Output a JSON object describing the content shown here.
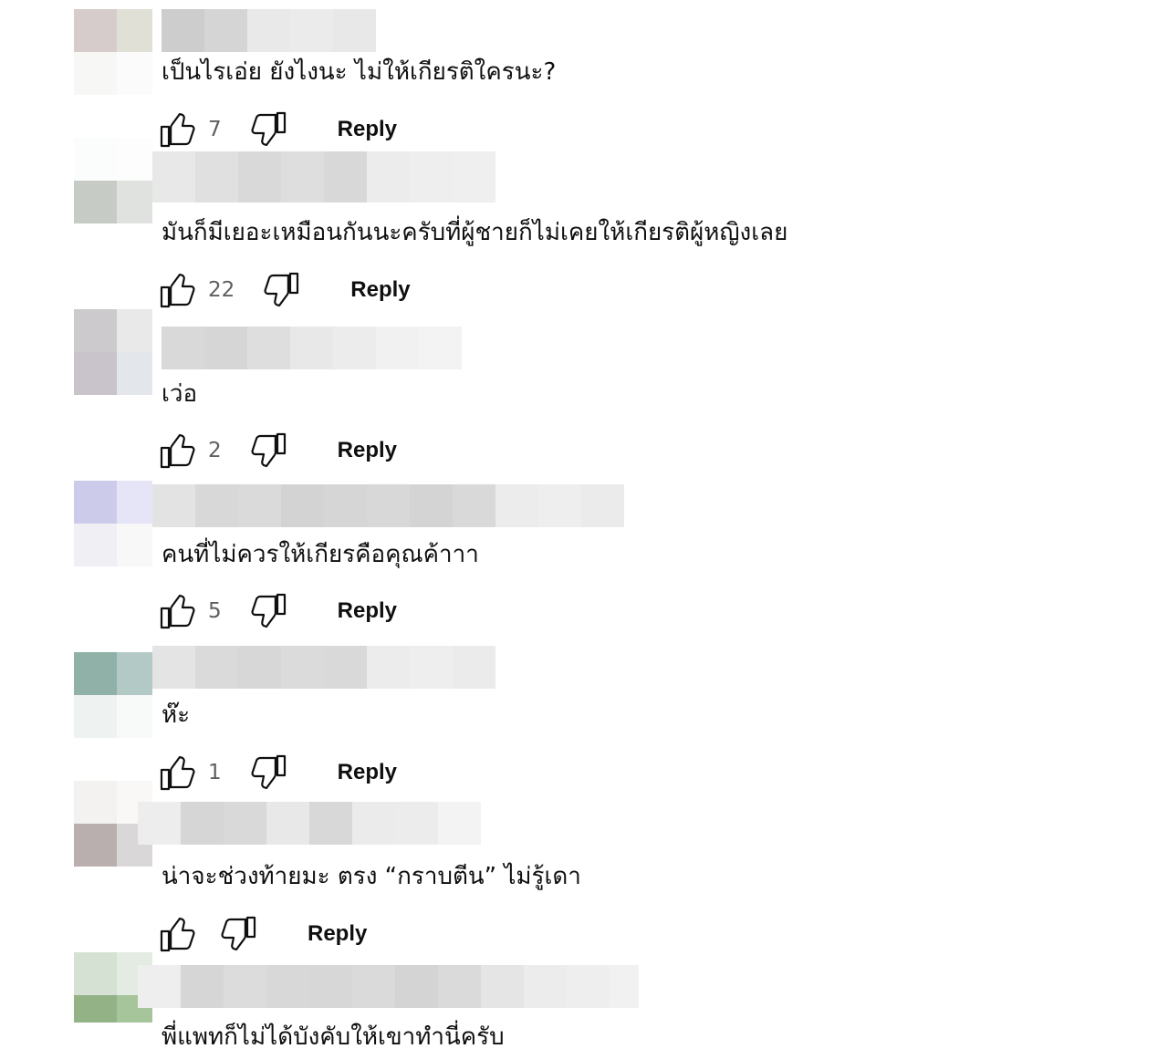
{
  "comments": [
    {
      "text": "เป็นไรเอ่ย ยังไงนะ ไม่ให้เกียรติใครนะ?",
      "likes": "7",
      "reply_label": "Reply",
      "avatar_colors": [
        "#d7cccc",
        "#e0e0d6",
        "#f7f7f5",
        "#fbfbfb"
      ],
      "name_blur_colors": [
        "#cdcdcd",
        "#d5d5d5",
        "#e9e9e9",
        "#ebebeb",
        "#e8e8e8"
      ]
    },
    {
      "text": "มันก็มีเยอะเหมือนกันนะครับที่ผู้ชายก็ไม่เคยให้เกียรติผู้หญิงเลย",
      "likes": "22",
      "reply_label": "Reply",
      "avatar_colors": [
        "#fbfdfc",
        "#fdfdfd",
        "#c6cbc6",
        "#dfe2df"
      ],
      "name_blur_colors": [
        "#e8e8e8",
        "#e0e0e0",
        "#d9d9d9",
        "#dedede",
        "#d8d8d8",
        "#ececec",
        "#eeeeee",
        "#efefef"
      ]
    },
    {
      "text": "เว่อ",
      "likes": "2",
      "reply_label": "Reply",
      "avatar_colors": [
        "#cdcacd",
        "#e9e9e9",
        "#c9c3cc",
        "#e3e6ea"
      ],
      "name_blur_colors": [
        "#d9d9d9",
        "#d6d6d6",
        "#dedede",
        "#e8e8e8",
        "#ececec",
        "#f1f1f1",
        "#f3f3f3"
      ]
    },
    {
      "text": "คนที่ไม่ควรให้เกียรคือคุณค้าาา",
      "likes": "5",
      "reply_label": "Reply",
      "avatar_colors": [
        "#cccbea",
        "#e6e5f7",
        "#f0f0f4",
        "#f8f8f8"
      ],
      "name_blur_colors": [
        "#e3e3e3",
        "#d8d8d8",
        "#dadada",
        "#d3d3d3",
        "#d6d6d6",
        "#d8d8d8",
        "#d4d4d4",
        "#d9d9d9",
        "#ececec",
        "#eeeeee",
        "#ebebeb"
      ]
    },
    {
      "text": "ห๊ะ",
      "likes": "1",
      "reply_label": "Reply",
      "avatar_colors": [
        "#8fb1a7",
        "#b3c9c5",
        "#eef3f1",
        "#f8faf9"
      ],
      "name_blur_colors": [
        "#e4e4e4",
        "#dadada",
        "#d7d7d7",
        "#dbdbdb",
        "#d9d9d9",
        "#ececec",
        "#eeeeee",
        "#ebebeb"
      ]
    },
    {
      "text": "น่าจะช่วงท้ายมะ ตรง “กราบตีน” ไม่รู้เดา",
      "likes": "",
      "reply_label": "Reply",
      "avatar_colors": [
        "#f3f2f0",
        "#f9f8f7",
        "#b9afaf",
        "#d9d7d7"
      ],
      "name_blur_colors": [
        "#ededed",
        "#d6d6d6",
        "#d9d9d9",
        "#e8e8e8",
        "#d8d8d8",
        "#ebebeb",
        "#ececec",
        "#f3f3f3"
      ]
    },
    {
      "text": "พี่แพทก็ไม่ได้บังคับให้เขาทำนี่ครับ",
      "likes": "",
      "reply_label": "",
      "avatar_colors": [
        "#d5e1d3",
        "#e3ebe2",
        "#93b285",
        "#a7c59a"
      ],
      "name_blur_colors": [
        "#eeeeee",
        "#d6d6d6",
        "#dcdcdc",
        "#d8d8d8",
        "#d7d7d7",
        "#dadada",
        "#d4d4d4",
        "#dadada",
        "#e5e5e5",
        "#ececec",
        "#eeeeee",
        "#f1f1f1"
      ]
    }
  ],
  "icons": {
    "like": "thumb-up-outline",
    "dislike": "thumb-down-outline"
  }
}
